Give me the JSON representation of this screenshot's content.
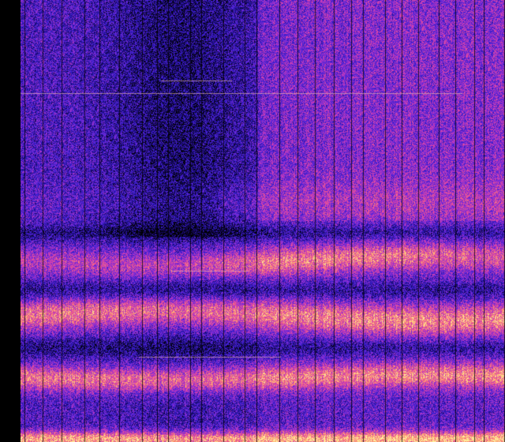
{
  "image": {
    "subject": "spectrogram",
    "colormap": [
      "#000000",
      "#1a0a78",
      "#3a1fd0",
      "#7a2bd8",
      "#c83ab8",
      "#f05a8a",
      "#ffb070",
      "#fff2a0"
    ],
    "background": "#000000"
  }
}
